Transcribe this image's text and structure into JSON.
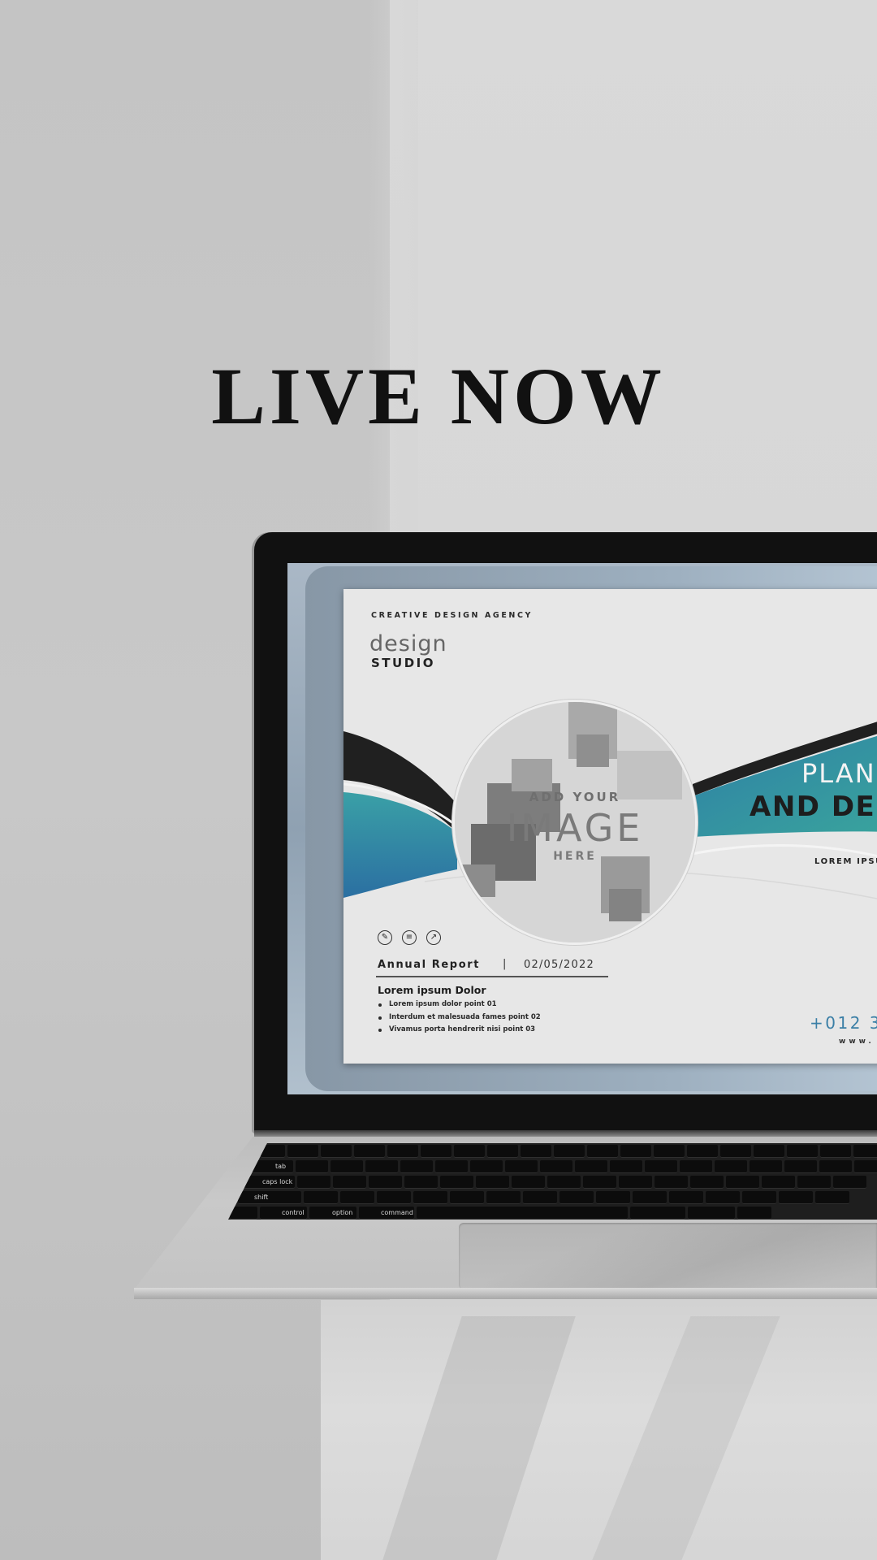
{
  "headline": "LIVE NOW",
  "screen_document": {
    "agency": "CREATIVE DESIGN AGENCY",
    "brand_word": "design",
    "brand_sub": "STUDIO",
    "image_placeholder": {
      "line1": "ADD YOUR",
      "line2": "IMAGE",
      "line3": "HERE"
    },
    "title_line1": "PLAN",
    "title_line2": "AND DE",
    "tagline": "LOREM IPSU",
    "report_label": "Annual Report",
    "separator": "|",
    "report_date": "02/05/2022",
    "section_heading": "Lorem ipsum Dolor",
    "points": [
      "Lorem ipsum dolor point 01",
      "Interdum et malesuada fames point 02",
      "Vivamus porta hendrerit nisi point 03"
    ],
    "phone": "+012 3",
    "website": "www. v",
    "accent_color": "#2f86a8",
    "accent_color_2": "#3aa3a0"
  },
  "keyboard_labels": {
    "tab": "tab",
    "caps_lock": "caps lock",
    "shift": "shift",
    "control": "control",
    "option": "option",
    "command": "command"
  },
  "icons": [
    "pen-icon",
    "layers-icon",
    "chart-icon"
  ]
}
